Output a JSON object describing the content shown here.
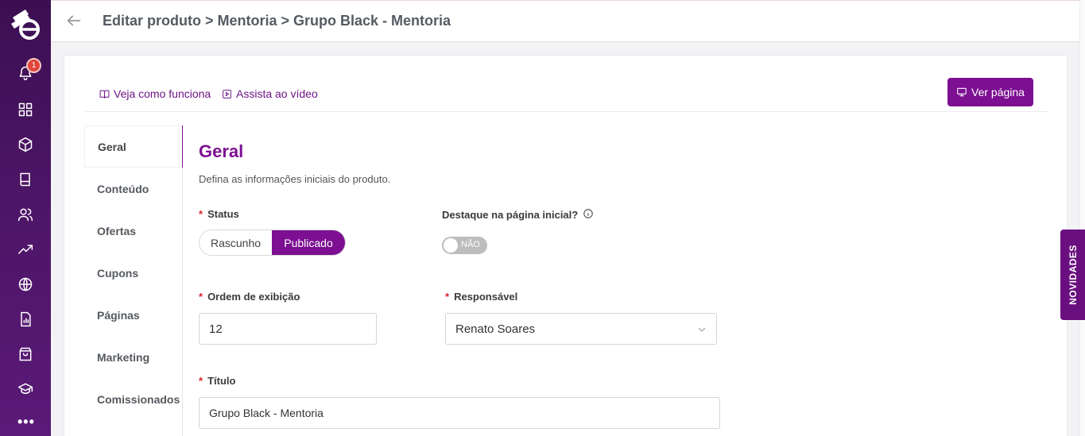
{
  "header": {
    "breadcrumb": "Editar produto > Mentoria > Grupo Black - Mentoria"
  },
  "rail": {
    "notification_count": "1",
    "more": "•••",
    "icons": [
      "logo",
      "bell-icon",
      "grid-icon",
      "box-icon",
      "book-icon",
      "users-icon",
      "trending-up-icon",
      "globe-icon",
      "report-icon",
      "shopping-bag-icon",
      "graduation-cap-icon",
      "more-icon"
    ]
  },
  "toolbar": {
    "help_link": "Veja como funciona",
    "video_link": "Assista ao vídeo",
    "view_page_button": "Ver página"
  },
  "menu": {
    "items": [
      {
        "label": "Geral",
        "active": true
      },
      {
        "label": "Conteúdo"
      },
      {
        "label": "Ofertas"
      },
      {
        "label": "Cupons"
      },
      {
        "label": "Páginas"
      },
      {
        "label": "Marketing"
      },
      {
        "label": "Comissionados"
      }
    ]
  },
  "form": {
    "section_title": "Geral",
    "section_description": "Defina as informações iniciais do produto.",
    "required_mark": "*",
    "status": {
      "label": "Status",
      "options": [
        "Rascunho",
        "Publicado"
      ],
      "selected": "Publicado"
    },
    "highlight": {
      "label": "Destaque na página inicial?",
      "toggle_text": "NÃO",
      "value": false
    },
    "order": {
      "label": "Ordem de exibição",
      "value": "12"
    },
    "responsible": {
      "label": "Responsável",
      "value": "Renato Soares"
    },
    "title": {
      "label": "Título",
      "value": "Grupo Black - Mentoria"
    }
  },
  "novidades_tab": "NOVIDADES",
  "colors": {
    "brand": "#7c0f92",
    "rail": "#4d1566",
    "required": "#d8232a"
  }
}
